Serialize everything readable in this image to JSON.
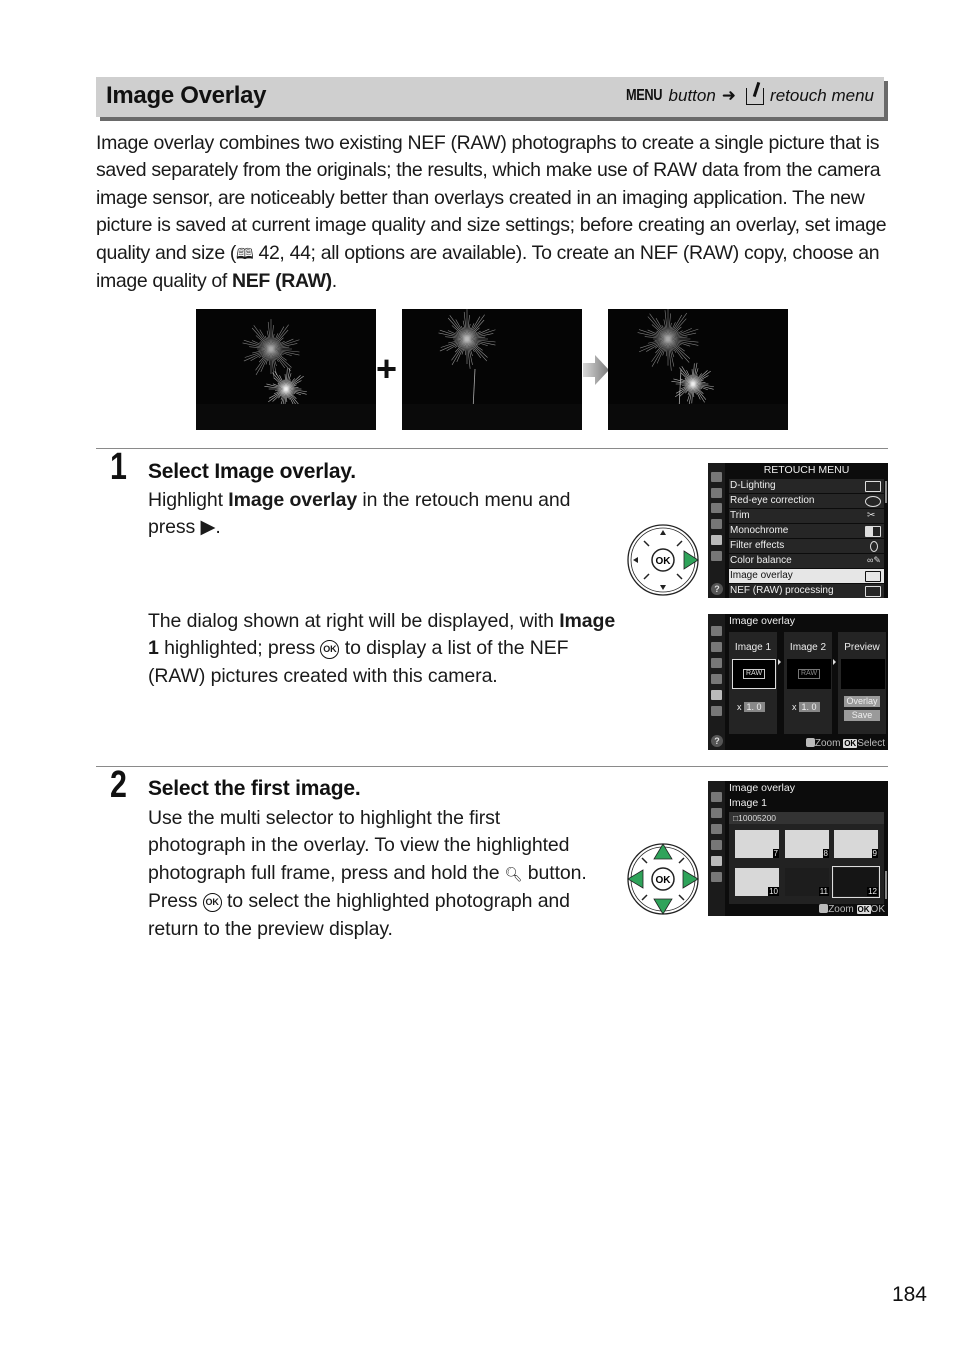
{
  "header": {
    "title": "Image Overlay",
    "path_menu": "MENU",
    "path_button": "button",
    "path_arrow": "➜",
    "path_icon": "retouch-menu-icon",
    "path_target": "retouch menu"
  },
  "intro": {
    "text": "Image overlay combines two existing NEF (RAW) photographs to create a single picture that is saved separately from the originals; the results, which make use of RAW data from the camera image sensor, are noticeably better than overlays created in an imaging application.  The new picture is saved at current image quality and size settings; before creating an overlay, set image quality and size (",
    "page_ref_icon": "🕮",
    "page_refs": " 42, 44; all options are available).  To create an NEF (RAW) copy, choose an image quality of ",
    "bold_tail": "NEF (RAW)",
    "end": "."
  },
  "illustration": {
    "images": [
      "Fireworks photo 1",
      "Fireworks photo 2",
      "Overlay result"
    ],
    "plus": "+",
    "arrow_icon": "right-arrow-icon"
  },
  "steps": [
    {
      "number": "1",
      "title_prefix": "Select ",
      "title_bold": "Image overlay.",
      "body1_prefix": "Highlight ",
      "body1_bold": "Image overlay",
      "body1_suffix": " in the retouch menu and press ▶.",
      "body2_bold": "Image 1",
      "body2_text_a": "The dialog shown at right will be displayed, with ",
      "body2_text_b": " highlighted; press ",
      "body2_ok": "OK",
      "body2_text_c": " to display a list of the NEF (RAW) pictures created with this camera."
    },
    {
      "number": "2",
      "title": "Select the first image.",
      "body_a": "Use the multi selector to highlight the first photograph in the overlay.  To view the highlighted photograph full frame, press and hold the ",
      "zoom_icon": "🔍︎",
      "body_b": " button.  Press ",
      "ok": "OK",
      "body_c": " to select the highlighted photograph and return to the preview display."
    }
  ],
  "retouch_menu": {
    "title": "RETOUCH MENU",
    "items": [
      {
        "label": "D-Lighting",
        "icon": "d-lighting-icon"
      },
      {
        "label": "Red-eye correction",
        "icon": "eye-icon"
      },
      {
        "label": "Trim",
        "icon": "scissors-icon"
      },
      {
        "label": "Monochrome",
        "icon": "monochrome-icon"
      },
      {
        "label": "Filter effects",
        "icon": "filter-icon"
      },
      {
        "label": "Color balance",
        "icon": "color-balance-icon"
      },
      {
        "label": "Image overlay",
        "icon": "overlay-icon",
        "selected": true
      },
      {
        "label": "NEF (RAW) processing",
        "icon": "raw-processing-icon"
      }
    ],
    "help": "?"
  },
  "overlay_dialog": {
    "title": "Image overlay",
    "panels": [
      {
        "label": "Image 1",
        "raw": "RAW",
        "gain_prefix": "x",
        "gain": "1. 0"
      },
      {
        "label": "Image 2",
        "raw": "RAW",
        "gain_prefix": "x",
        "gain": "1. 0"
      },
      {
        "label": "Preview"
      }
    ],
    "overlay_btn": "Overlay",
    "save_btn": "Save",
    "footer_zoom": "Zoom",
    "footer_ok": "OK",
    "footer_select": "Select",
    "help": "?"
  },
  "image_picker": {
    "title": "Image overlay",
    "subtitle": "Image 1",
    "folder": "□10005200",
    "thumbs": [
      "7",
      "8",
      "9",
      "10",
      "11",
      "12"
    ],
    "selected_thumb": "12",
    "footer_zoom": "Zoom",
    "footer_ok": "OK",
    "footer_ok_label": "OK"
  },
  "page_number": "184"
}
